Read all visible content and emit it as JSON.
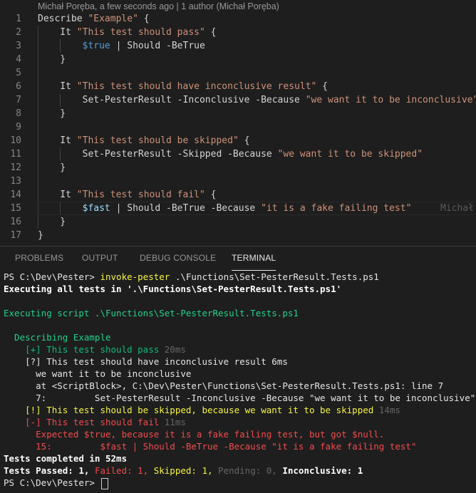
{
  "blame": "Michał Poręba, a few seconds ago | 1 author (Michał Poręba)",
  "editor": {
    "ghost_text": "Michał",
    "lines": [
      {
        "n": "1",
        "tokens": [
          {
            "t": "Describe ",
            "c": "kw"
          },
          {
            "t": "\"Example\"",
            "c": "str"
          },
          {
            "t": " {",
            "c": "kw"
          }
        ]
      },
      {
        "n": "2",
        "tokens": [
          {
            "t": "    It ",
            "c": "kw"
          },
          {
            "t": "\"This test should pass\"",
            "c": "str"
          },
          {
            "t": " {",
            "c": "kw"
          }
        ]
      },
      {
        "n": "3",
        "tokens": [
          {
            "t": "        ",
            "c": "kw"
          },
          {
            "t": "$true",
            "c": "varb"
          },
          {
            "t": " | Should -BeTrue",
            "c": "cmd"
          }
        ]
      },
      {
        "n": "4",
        "tokens": [
          {
            "t": "    }",
            "c": "kw"
          }
        ]
      },
      {
        "n": "5",
        "tokens": []
      },
      {
        "n": "6",
        "tokens": [
          {
            "t": "    It ",
            "c": "kw"
          },
          {
            "t": "\"This test should have inconclusive result\"",
            "c": "str"
          },
          {
            "t": " {",
            "c": "kw"
          }
        ]
      },
      {
        "n": "7",
        "tokens": [
          {
            "t": "        Set-PesterResult -Inconclusive -Because ",
            "c": "cmd"
          },
          {
            "t": "\"we want it to be inconclusive\"",
            "c": "str"
          }
        ]
      },
      {
        "n": "8",
        "tokens": [
          {
            "t": "    }",
            "c": "kw"
          }
        ]
      },
      {
        "n": "9",
        "tokens": []
      },
      {
        "n": "10",
        "tokens": [
          {
            "t": "    It ",
            "c": "kw"
          },
          {
            "t": "\"This test should be skipped\"",
            "c": "str"
          },
          {
            "t": " {",
            "c": "kw"
          }
        ]
      },
      {
        "n": "11",
        "tokens": [
          {
            "t": "        Set-PesterResult -Skipped -Because ",
            "c": "cmd"
          },
          {
            "t": "\"we want it to be skipped\"",
            "c": "str"
          }
        ]
      },
      {
        "n": "12",
        "tokens": [
          {
            "t": "    }",
            "c": "kw"
          }
        ]
      },
      {
        "n": "13",
        "tokens": []
      },
      {
        "n": "14",
        "tokens": [
          {
            "t": "    It ",
            "c": "kw"
          },
          {
            "t": "\"This test should fail\"",
            "c": "str"
          },
          {
            "t": " {",
            "c": "kw"
          }
        ]
      },
      {
        "n": "15",
        "tokens": [
          {
            "t": "        ",
            "c": "kw"
          },
          {
            "t": "$fast",
            "c": "var"
          },
          {
            "t": " | Should -BeTrue -Because ",
            "c": "cmd"
          },
          {
            "t": "\"it is a fake failing test\"",
            "c": "str"
          }
        ]
      },
      {
        "n": "16",
        "tokens": [
          {
            "t": "    }",
            "c": "kw"
          }
        ]
      },
      {
        "n": "17",
        "tokens": [
          {
            "t": "}",
            "c": "kw"
          }
        ]
      }
    ]
  },
  "panel": {
    "tabs": [
      "PROBLEMS",
      "OUTPUT",
      "DEBUG CONSOLE",
      "TERMINAL"
    ],
    "active_tab": "TERMINAL"
  },
  "terminal": {
    "lines": [
      [
        {
          "t": "PS C:\\Dev\\Pester> ",
          "c": "w"
        },
        {
          "t": "invoke-pester",
          "c": "y"
        },
        {
          "t": " .\\Functions\\Set-PesterResult.Tests.ps1",
          "c": "w"
        }
      ],
      [
        {
          "t": "Executing all tests in '.\\Functions\\Set-PesterResult.Tests.ps1'",
          "c": "bw"
        }
      ],
      [],
      [
        {
          "t": "Executing script .\\Functions\\Set-PesterResult.Tests.ps1",
          "c": "g"
        }
      ],
      [],
      [
        {
          "t": "  Describing Example",
          "c": "g"
        }
      ],
      [
        {
          "t": "    [+] This test should pass",
          "c": "gd"
        },
        {
          "t": " 20ms",
          "c": "gr"
        }
      ],
      [
        {
          "t": "    [?] This test should have inconclusive result 6ms",
          "c": "w"
        }
      ],
      [
        {
          "t": "      we want it to be inconclusive",
          "c": "w"
        }
      ],
      [
        {
          "t": "      at <ScriptBlock>, C:\\Dev\\Pester\\Functions\\Set-PesterResult.Tests.ps1: line 7",
          "c": "w"
        }
      ],
      [
        {
          "t": "      7:         Set-PesterResult -Inconclusive -Because \"we want it to be inconclusive\"",
          "c": "w"
        }
      ],
      [
        {
          "t": "    [!] This test should be skipped, because we want it to be skipped",
          "c": "y"
        },
        {
          "t": " 14ms",
          "c": "gr"
        }
      ],
      [
        {
          "t": "    [-] This test should fail",
          "c": "r"
        },
        {
          "t": " 11ms",
          "c": "gr"
        }
      ],
      [
        {
          "t": "      Expected $true, because it is a fake failing test, but got $null.",
          "c": "r"
        }
      ],
      [
        {
          "t": "      15:         $fast | Should -BeTrue -Because \"it is a fake failing test\"",
          "c": "r"
        }
      ],
      [
        {
          "t": "Tests completed in 52ms",
          "c": "bw"
        }
      ],
      [
        {
          "t": "Tests Passed: 1, ",
          "c": "bw"
        },
        {
          "t": "Failed: 1, ",
          "c": "r"
        },
        {
          "t": "Skipped: 1, ",
          "c": "y"
        },
        {
          "t": "Pending: 0, ",
          "c": "gr"
        },
        {
          "t": "Inconclusive: 1",
          "c": "bw"
        }
      ],
      [
        {
          "t": "PS C:\\Dev\\Pester> ",
          "c": "w"
        }
      ]
    ]
  }
}
